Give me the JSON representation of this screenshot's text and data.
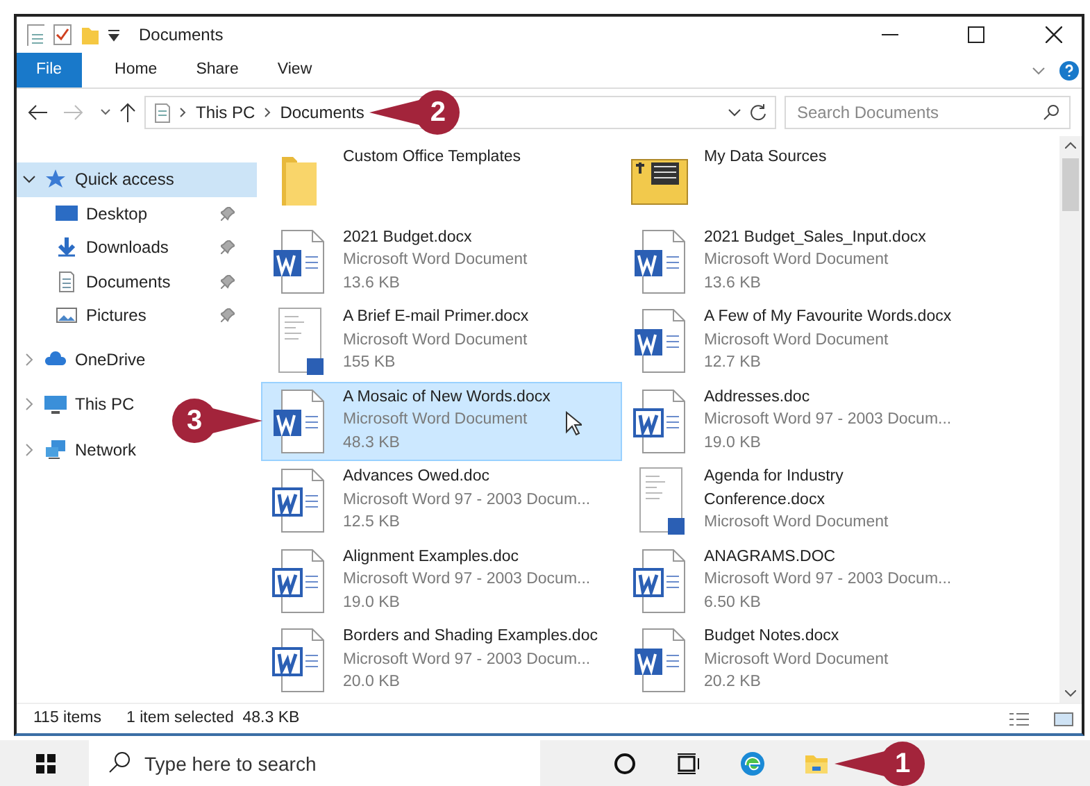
{
  "window": {
    "title": "Documents"
  },
  "ribbon": {
    "tabs": [
      {
        "label": "File",
        "kind": "file"
      },
      {
        "label": "Home",
        "kind": "tab"
      },
      {
        "label": "Share",
        "kind": "tab"
      },
      {
        "label": "View",
        "kind": "tab"
      }
    ]
  },
  "address": {
    "path": [
      "This PC",
      "Documents"
    ],
    "callout": "2",
    "search_placeholder": "Search Documents"
  },
  "nav": [
    {
      "label": "Quick access",
      "kind": "star",
      "expanded": true,
      "selected": true,
      "children": [
        {
          "label": "Desktop",
          "kind": "desktop",
          "pinned": true,
          "selected": false
        },
        {
          "label": "Downloads",
          "kind": "downloads",
          "pinned": true,
          "selected": false
        },
        {
          "label": "Documents",
          "kind": "documents",
          "pinned": true,
          "selected": false
        },
        {
          "label": "Pictures",
          "kind": "pictures",
          "pinned": true,
          "selected": false
        }
      ]
    },
    {
      "label": "OneDrive",
      "kind": "cloud",
      "expanded": false,
      "selected": false
    },
    {
      "label": "This PC",
      "kind": "pc",
      "expanded": false,
      "selected": false
    },
    {
      "label": "Network",
      "kind": "network",
      "expanded": false,
      "selected": false
    }
  ],
  "files": [
    {
      "name": "Custom Office Templates",
      "kind": "folder",
      "selected": false
    },
    {
      "name": "My Data Sources",
      "kind": "datasource",
      "selected": false
    },
    {
      "name": "2021 Budget.docx",
      "type": "Microsoft Word Document",
      "size": "13.6 KB",
      "kind": "docx",
      "selected": false
    },
    {
      "name": "2021 Budget_Sales_Input.docx",
      "type": "Microsoft Word Document",
      "size": "13.6 KB",
      "kind": "docx",
      "selected": false
    },
    {
      "name": "A Brief E-mail Primer.docx",
      "type": "Microsoft Word Document",
      "size": "155 KB",
      "kind": "thumb",
      "selected": false
    },
    {
      "name": "A Few of My Favourite Words.docx",
      "type": "Microsoft Word Document",
      "size": "12.7 KB",
      "kind": "docx",
      "selected": false
    },
    {
      "name": "A Mosaic of New Words.docx",
      "type": "Microsoft Word Document",
      "size": "48.3 KB",
      "kind": "docx",
      "selected": true,
      "callout": "3"
    },
    {
      "name": "Addresses.doc",
      "type": "Microsoft Word 97 - 2003 Docum...",
      "size": "19.0 KB",
      "kind": "doc",
      "selected": false
    },
    {
      "name": "Advances Owed.doc",
      "type": "Microsoft Word 97 - 2003 Docum...",
      "size": "12.5 KB",
      "kind": "doc",
      "selected": false
    },
    {
      "name": "Agenda for Industry Conference.docx",
      "type": "Microsoft Word Document",
      "kind": "thumb",
      "selected": false
    },
    {
      "name": "Alignment Examples.doc",
      "type": "Microsoft Word 97 - 2003 Docum...",
      "size": "19.0 KB",
      "kind": "doc",
      "selected": false
    },
    {
      "name": "ANAGRAMS.DOC",
      "type": "Microsoft Word 97 - 2003 Docum...",
      "size": "6.50 KB",
      "kind": "doc",
      "selected": false
    },
    {
      "name": "Borders and Shading Examples.doc",
      "type": "Microsoft Word 97 - 2003 Docum...",
      "size": "20.0 KB",
      "kind": "doc",
      "selected": false
    },
    {
      "name": "Budget Notes.docx",
      "type": "Microsoft Word Document",
      "size": "20.2 KB",
      "kind": "docx",
      "selected": false
    }
  ],
  "status_bar": {
    "count": "115 items",
    "selection": "1 item selected  48.3 KB"
  },
  "taskbar": {
    "search_placeholder": "Type here to search",
    "apps": [
      {
        "kind": "cortana"
      },
      {
        "kind": "taskview"
      },
      {
        "kind": "edge"
      },
      {
        "kind": "explorer",
        "callout": "1"
      }
    ]
  }
}
